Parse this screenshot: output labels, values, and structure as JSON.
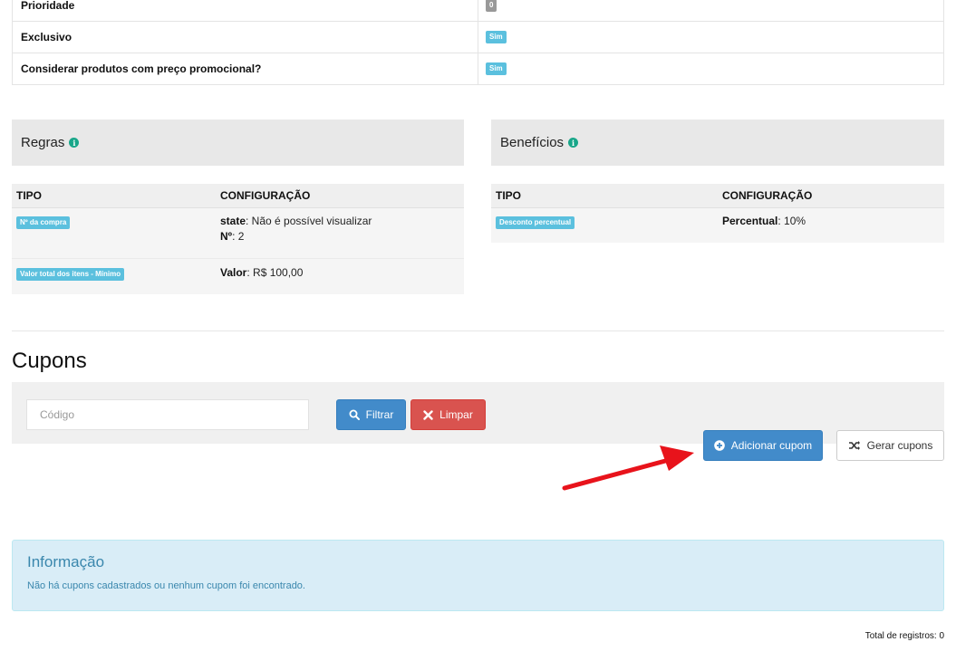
{
  "props": [
    {
      "key": "Prioridade",
      "value": "0",
      "color": "#999999"
    },
    {
      "key": "Exclusivo",
      "value": "Sim",
      "color": "#5bc0de"
    },
    {
      "key": "Considerar produtos com preço promocional?",
      "value": "Sim",
      "color": "#5bc0de"
    }
  ],
  "rules": {
    "title": "Regras",
    "col_type": "TIPO",
    "col_config": "CONFIGURAÇÃO",
    "rows": [
      {
        "type": "Nº da compra",
        "config": [
          {
            "k": "state",
            "v": ": Não é possível visualizar"
          },
          {
            "k": "Nº",
            "v": ": 2"
          }
        ]
      },
      {
        "type": "Valor total dos itens - Mínimo",
        "config": [
          {
            "k": "Valor",
            "v": ": R$ 100,00"
          }
        ]
      }
    ]
  },
  "benefits": {
    "title": "Benefícios",
    "col_type": "TIPO",
    "col_config": "CONFIGURAÇÃO",
    "rows": [
      {
        "type": "Desconto percentual",
        "config": [
          {
            "k": "Percentual",
            "v": ": 10%"
          }
        ]
      }
    ]
  },
  "coupons": {
    "title": "Cupons",
    "code_placeholder": "Código",
    "filter_label": "Filtrar",
    "clear_label": "Limpar",
    "add_label": "Adicionar cupom",
    "generate_label": "Gerar cupons"
  },
  "alert": {
    "title": "Informação",
    "text": "Não há cupons cadastrados ou nenhum cupom foi encontrado."
  },
  "total_text": "Total de registros: 0",
  "icons": {
    "info": "info-icon",
    "search": "search-icon",
    "clear": "close-icon",
    "add": "plus-circle-icon",
    "generate": "shuffle-icon",
    "annotation": "red-arrow-annotation"
  },
  "colors": {
    "primary": "#428bca",
    "danger": "#d9534f",
    "info_label": "#5bc0de",
    "info_icon": "#18a689",
    "alert_bg": "#d9edf7",
    "alert_text": "#3a87ad",
    "annotation": "#e8131b"
  }
}
